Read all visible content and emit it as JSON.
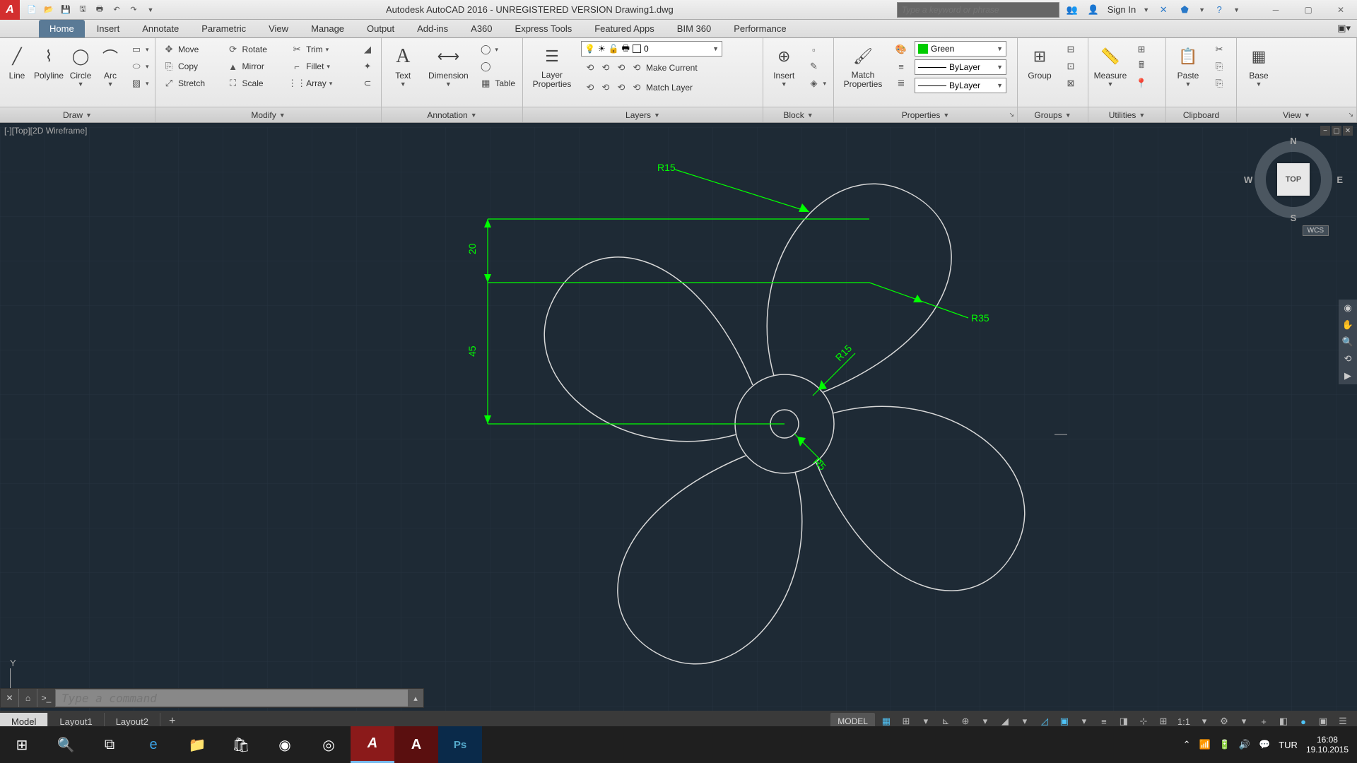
{
  "title": "Autodesk AutoCAD 2016 - UNREGISTERED VERSION   Drawing1.dwg",
  "search_placeholder": "Type a keyword or phrase",
  "sign_in": "Sign In",
  "tabs": [
    "Home",
    "Insert",
    "Annotate",
    "Parametric",
    "View",
    "Manage",
    "Output",
    "Add-ins",
    "A360",
    "Express Tools",
    "Featured Apps",
    "BIM 360",
    "Performance"
  ],
  "active_tab": 0,
  "panels": {
    "draw": {
      "title": "Draw",
      "items": [
        "Line",
        "Polyline",
        "Circle",
        "Arc"
      ]
    },
    "modify": {
      "title": "Modify",
      "items": [
        "Move",
        "Rotate",
        "Trim",
        "Copy",
        "Mirror",
        "Fillet",
        "Stretch",
        "Scale",
        "Array"
      ]
    },
    "annotation": {
      "title": "Annotation",
      "items": [
        "Text",
        "Dimension",
        "Table"
      ]
    },
    "layers": {
      "title": "Layers",
      "main": "Layer Properties",
      "current": "0",
      "buttons": [
        "Make Current",
        "Match Layer"
      ]
    },
    "block": {
      "title": "Block",
      "main": "Insert"
    },
    "properties": {
      "title": "Properties",
      "main": "Match Properties",
      "color": "Green",
      "lw": "ByLayer",
      "lt": "ByLayer"
    },
    "groups": {
      "title": "Groups",
      "main": "Group"
    },
    "utilities": {
      "title": "Utilities",
      "main": "Measure"
    },
    "clipboard": {
      "title": "Clipboard",
      "main": "Paste"
    },
    "view": {
      "title": "View",
      "main": "Base"
    }
  },
  "viewport_label": "[-][Top][2D Wireframe]",
  "viewcube": {
    "face": "TOP",
    "n": "N",
    "s": "S",
    "e": "E",
    "w": "W",
    "wcs": "WCS"
  },
  "ucs_y": "Y",
  "cmdline_placeholder": "Type a command",
  "layout_tabs": [
    "Model",
    "Layout1",
    "Layout2"
  ],
  "status": {
    "model": "MODEL",
    "scale": "1:1",
    "lang": "TUR"
  },
  "clock": {
    "time": "16:08",
    "date": "19.10.2015"
  },
  "dims": {
    "d20": "20",
    "d45": "45",
    "r15": "R15",
    "r35": "R35",
    "r15b": "R15",
    "r5": "R5"
  }
}
